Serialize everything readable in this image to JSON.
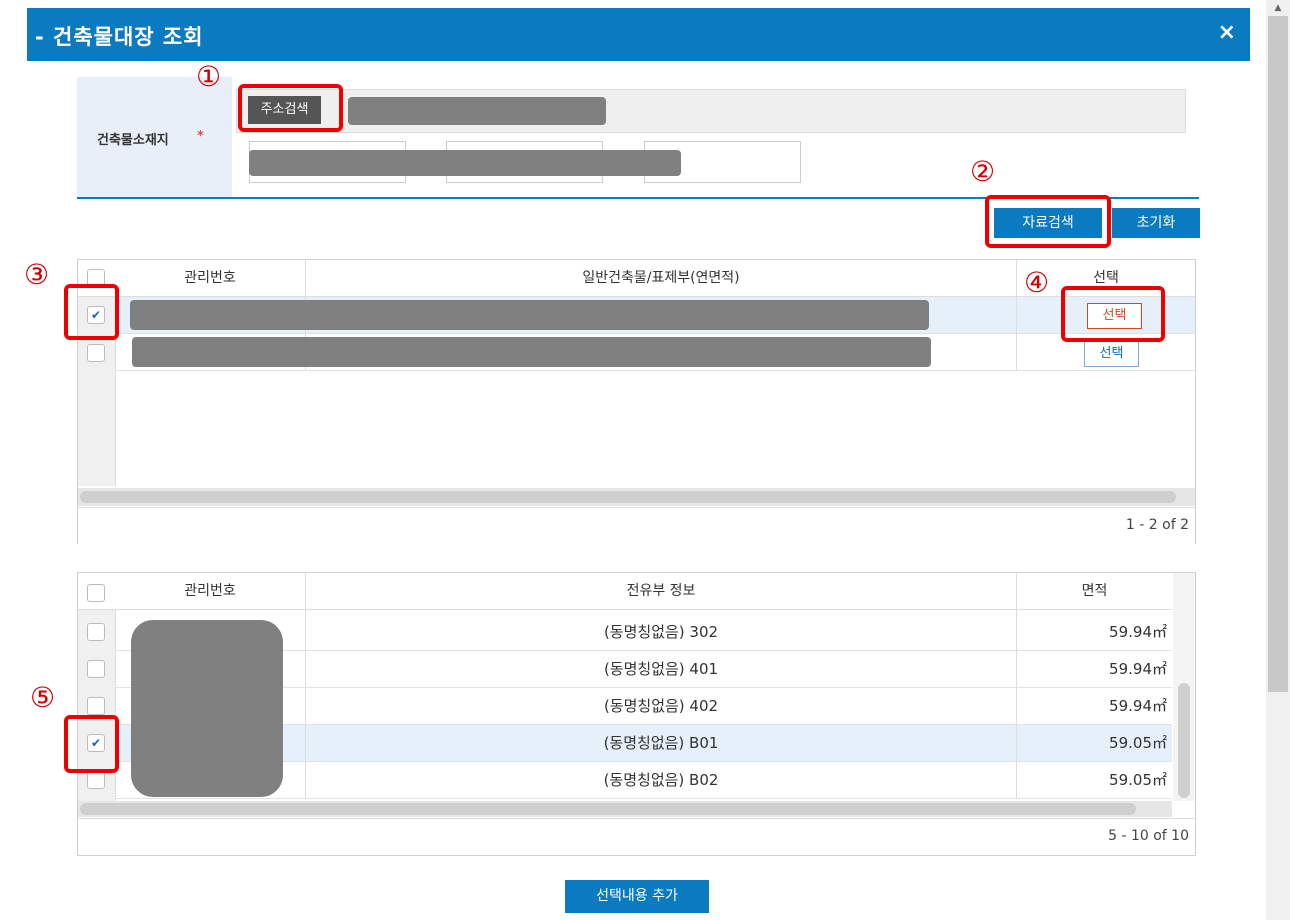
{
  "dialog": {
    "title": "- 건축물대장 조회",
    "close_label": "×"
  },
  "form": {
    "location_label": "건축물소재지",
    "required_mark": "*",
    "address_search_button": "주소검색",
    "search_button": "자료검색",
    "reset_button": "초기화"
  },
  "markers": [
    "①",
    "②",
    "③",
    "④",
    "⑤"
  ],
  "building_grid": {
    "columns": [
      "관리번호",
      "일반건축물/표제부(연면적)",
      "선택"
    ],
    "rows": [
      {
        "checked": true,
        "select_label": "선택"
      },
      {
        "checked": false,
        "select_label": "선택"
      }
    ],
    "pager": "1 - 2 of 2"
  },
  "unit_grid": {
    "columns": [
      "관리번호",
      "전유부 정보",
      "면적"
    ],
    "rows": [
      {
        "checked": false,
        "info": "(동명칭없음) 302",
        "area": "59.94㎡"
      },
      {
        "checked": false,
        "info": "(동명칭없음) 401",
        "area": "59.94㎡"
      },
      {
        "checked": false,
        "info": "(동명칭없음) 402",
        "area": "59.94㎡"
      },
      {
        "checked": true,
        "info": "(동명칭없음) B01",
        "area": "59.05㎡"
      },
      {
        "checked": false,
        "info": "(동명칭없음) B02",
        "area": "59.05㎡"
      }
    ],
    "pager": "5 - 10 of 10"
  },
  "footer": {
    "add_button": "선택내용 추가"
  },
  "colors": {
    "primary": "#0a7ac1",
    "marker": "#e00000",
    "selected_row": "#e6f0fb"
  },
  "icons": {
    "close": "close-icon",
    "check": "check-icon"
  }
}
